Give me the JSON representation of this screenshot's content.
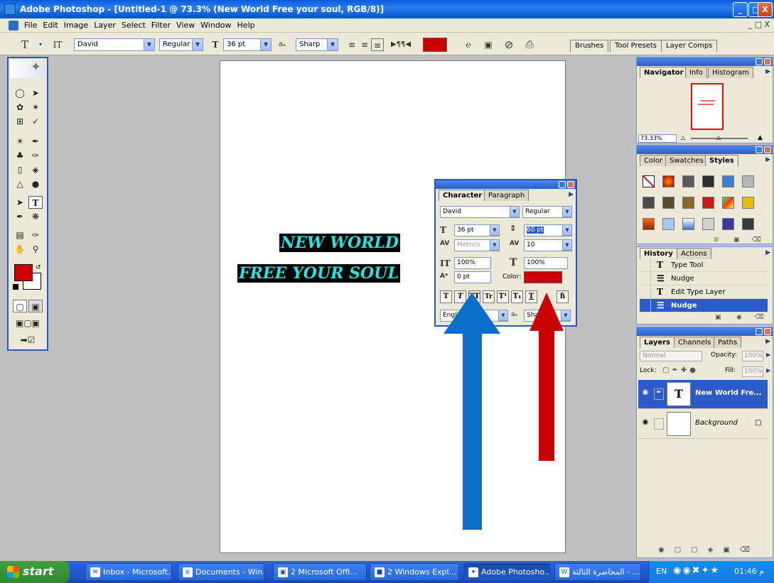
{
  "window": {
    "title": "Adobe Photoshop - [Untitled-1 @ 73.3% (New World Free your soul, RGB/8)]",
    "minimize": "_",
    "maximize": "□",
    "close": "X"
  },
  "menu": {
    "items": [
      "File",
      "Edit",
      "Image",
      "Layer",
      "Select",
      "Filter",
      "View",
      "Window",
      "Help"
    ],
    "doc_controls": "_ □ X"
  },
  "options_bar": {
    "tool_glyph": "T",
    "orient_glyph": "IT",
    "font_family": "David",
    "font_style": "Regular",
    "font_size": "36 pt",
    "aa_label": "aₐ",
    "antialias": "Sharp",
    "text_color": "#cc0000",
    "palette_tabs": [
      "Brushes",
      "Tool Presets",
      "Layer Comps"
    ]
  },
  "document": {
    "zoom": "73.3%",
    "lines": [
      "NEW WORLD",
      "FREE YOUR SOUL"
    ],
    "text_color": "#28e2e0"
  },
  "navigator": {
    "tabs": [
      "Navigator",
      "Info",
      "Histogram"
    ],
    "zoom": "73.33%"
  },
  "styles_panel": {
    "tabs": [
      "Color",
      "Swatches",
      "Styles"
    ]
  },
  "history": {
    "tabs": [
      "History",
      "Actions"
    ],
    "items": [
      {
        "label": "Type Tool",
        "icon": "T"
      },
      {
        "label": "Nudge",
        "icon": "☰"
      },
      {
        "label": "Edit Type Layer",
        "icon": "T"
      },
      {
        "label": "Nudge",
        "icon": "☰"
      }
    ]
  },
  "layers": {
    "tabs": [
      "Layers",
      "Channels",
      "Paths"
    ],
    "blend_mode": "Normal",
    "opacity_label": "Opacity:",
    "opacity": "100%",
    "lock_label": "Lock:",
    "fill_label": "Fill:",
    "fill": "100%",
    "items": [
      {
        "name": "New World Fre...",
        "thumb": "T"
      },
      {
        "name": "Background",
        "thumb": ""
      }
    ]
  },
  "character": {
    "tabs": [
      "Character",
      "Paragraph"
    ],
    "font_family": "David",
    "font_style": "Regular",
    "size": "36 pt",
    "leading": "60 pt",
    "kerning": "Metrics",
    "tracking": "10",
    "vertical_scale": "100%",
    "horizontal_scale": "100%",
    "baseline_shift": "0 pt",
    "color_label": "Color:",
    "color": "#cc0000",
    "language": "English",
    "antialias": "Sharp",
    "style_buttons": [
      "T",
      "T",
      "TT",
      "Tr",
      "T¹",
      "T₁",
      "T",
      "fi"
    ]
  },
  "taskbar": {
    "start": "start",
    "items": [
      "Inbox - Microsoft...",
      "Documents - Win...",
      "2 Microsoft Offi...",
      "2 Windows Expl...",
      "Adobe Photosho...",
      "المحاضرة الثالثة - ..."
    ],
    "lang": "EN",
    "clock": "01:46 م"
  },
  "colors": {
    "foreground": "#cc0000",
    "background": "#ffffff",
    "blue_arrow": "#0a6fc8",
    "red_arrow": "#c80000"
  }
}
